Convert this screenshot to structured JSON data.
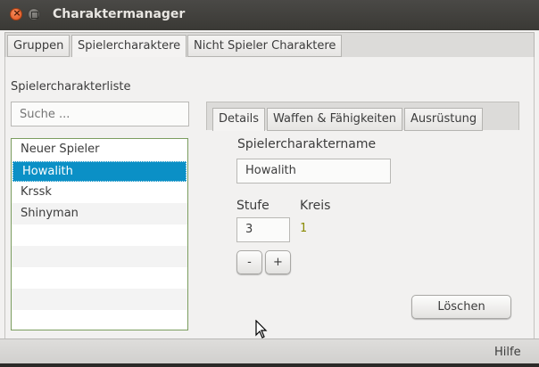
{
  "window": {
    "title": "Charaktermanager"
  },
  "main_tabs": [
    {
      "label": "Gruppen",
      "active": false
    },
    {
      "label": "Spielercharaktere",
      "active": true
    },
    {
      "label": "Nicht Spieler Charaktere",
      "active": false
    }
  ],
  "list_panel": {
    "heading": "Spielercharakterliste",
    "search": {
      "placeholder": "Suche ...",
      "value": ""
    },
    "items": [
      "Neuer Spieler",
      "Howalith",
      "Krssk",
      "Shinyman"
    ],
    "selected_item": "Howalith"
  },
  "detail_tabs": [
    {
      "label": "Details",
      "active": true
    },
    {
      "label": "Waffen & Fähigkeiten",
      "active": false
    },
    {
      "label": "Ausrüstung",
      "active": false
    }
  ],
  "details": {
    "name_label": "Spielercharaktername",
    "name_value": "Howalith",
    "level_label": "Stufe",
    "level_value": "3",
    "circle_label": "Kreis",
    "circle_value": "1",
    "decrement_label": "-",
    "increment_label": "+",
    "delete_label": "Löschen"
  },
  "footer": {
    "help_label": "Hilfe"
  },
  "colors": {
    "selection": "#0b90c6",
    "list_border": "#7b9d5f",
    "circle_value": "#8a8a00"
  },
  "icons": {
    "close": "close-icon",
    "minimize": "minimize-icon",
    "cursor": "mouse-pointer-icon"
  }
}
